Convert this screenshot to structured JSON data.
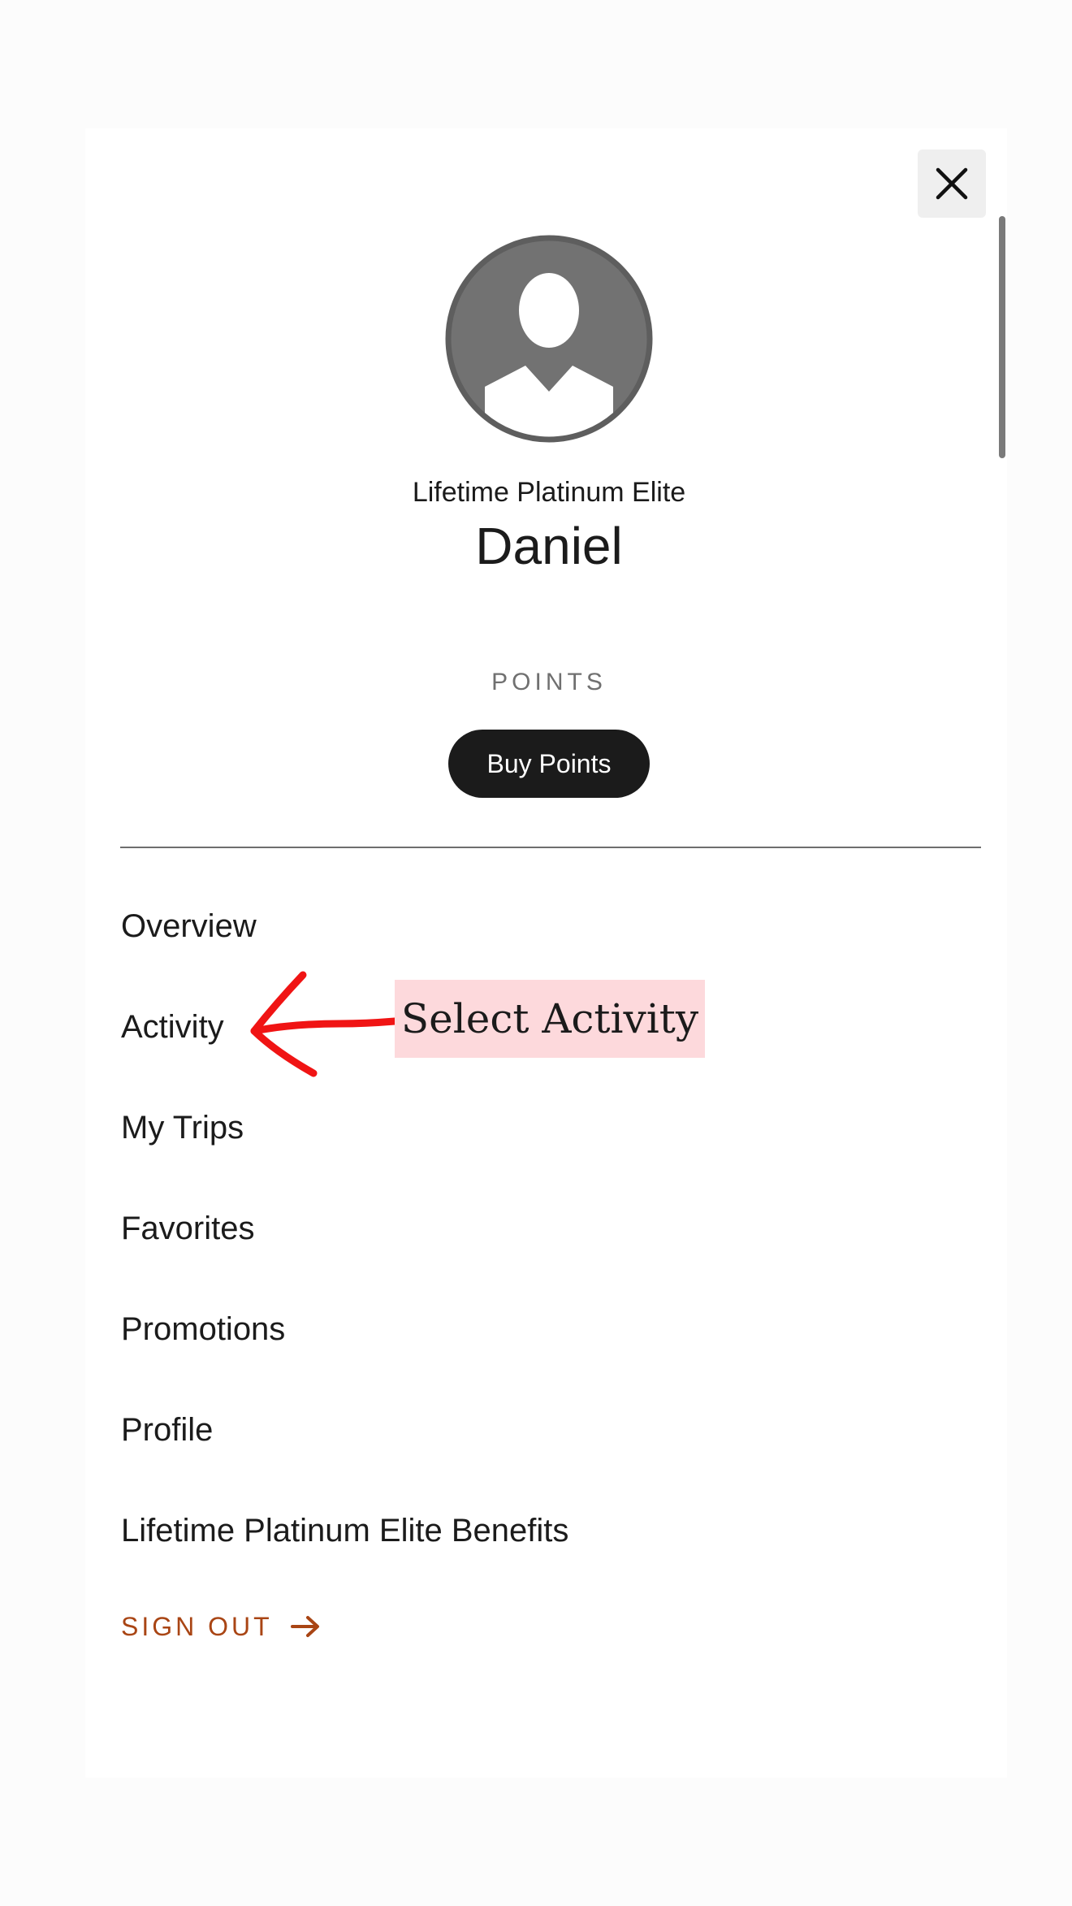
{
  "profile": {
    "tier": "Lifetime Platinum Elite",
    "name": "Daniel"
  },
  "points": {
    "label": "POINTS",
    "buy_label": "Buy Points"
  },
  "menu": {
    "items": [
      {
        "label": "Overview"
      },
      {
        "label": "Activity"
      },
      {
        "label": "My Trips"
      },
      {
        "label": "Favorites"
      },
      {
        "label": "Promotions"
      },
      {
        "label": "Profile"
      },
      {
        "label": "Lifetime Platinum Elite Benefits"
      }
    ],
    "sign_out_label": "SIGN OUT"
  },
  "annotation": {
    "text": "Select Activity"
  },
  "icons": {
    "close": "close-icon",
    "avatar": "user-avatar-icon",
    "sign_out": "arrow-right-icon"
  },
  "colors": {
    "primary_text": "#1b1b1b",
    "button_bg": "#1b1b1b",
    "sign_out": "#a94514",
    "annotation_arrow": "#f01414",
    "annotation_bg": "#fdd9dc"
  }
}
